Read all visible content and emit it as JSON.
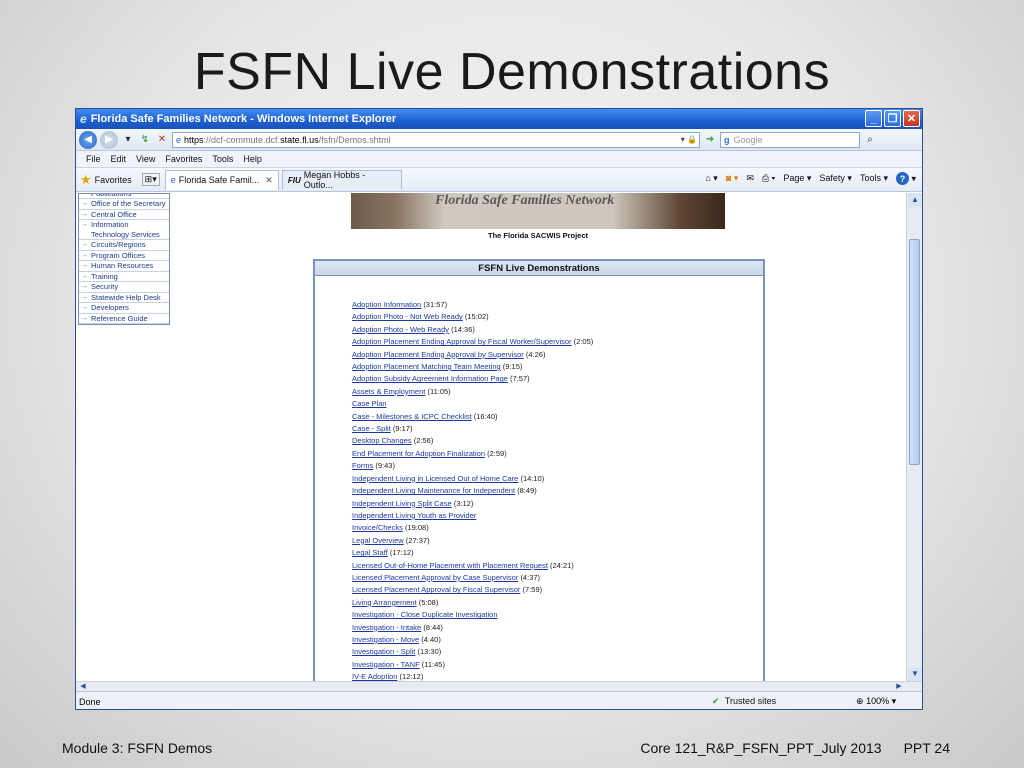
{
  "slide": {
    "title": "FSFN Live Demonstrations",
    "footer_left": "Module 3: FSFN Demos",
    "footer_center": "Core 121_R&P_FSFN_PPT_July 2013",
    "footer_right": "PPT 24"
  },
  "browser": {
    "title": "Florida Safe Families Network - Windows Internet Explorer",
    "url_scheme": "https",
    "url_prefix": "://dcf-commute.dcf.",
    "url_host": "state.fl.us",
    "url_path": "/fsfn/Demos.shtml",
    "search_placeholder": "Google",
    "menu": [
      "File",
      "Edit",
      "View",
      "Favorites",
      "Tools",
      "Help"
    ],
    "favorites_label": "Favorites",
    "tabs": [
      {
        "label": "Florida Safe Famil...",
        "active": true
      },
      {
        "label": "Megan Hobbs - Outlo...",
        "active": false
      }
    ],
    "commands": [
      "Page ▾",
      "Safety ▾",
      "Tools ▾"
    ],
    "status_text": "Done",
    "zone_text": "Trusted sites",
    "zoom_text": "100%"
  },
  "sidebar": {
    "items": [
      "Publications",
      "Office of the Secretary",
      "Central Office",
      "Information Technology Services",
      "Circuits/Regions",
      "Program Offices",
      "Human Resources",
      "Training",
      "Security",
      "Statewide Help Desk",
      "Developers",
      "Reference Guide"
    ]
  },
  "banner": {
    "text": "Florida Safe Families Network",
    "caption": "The Florida SACWIS Project"
  },
  "demos": {
    "header": "FSFN Live Demonstrations",
    "items": [
      {
        "title": "Adoption Information",
        "duration": "(31:57)"
      },
      {
        "title": "Adoption Photo - Not Web Ready",
        "duration": "(15:02)"
      },
      {
        "title": "Adoption Photo - Web Ready",
        "duration": "(14:36)"
      },
      {
        "title": "Adoption Placement Ending Approval by Fiscal Worker/Supervisor",
        "duration": "(2:05)"
      },
      {
        "title": "Adoption Placement Ending Approval by Supervisor",
        "duration": "(4:26)"
      },
      {
        "title": "Adoption Placement Matching Team Meeting",
        "duration": "(9:15)"
      },
      {
        "title": "Adoption Subsidy Agreement Information Page",
        "duration": "(7:57)"
      },
      {
        "title": "Assets & Employment",
        "duration": "(11:05)"
      },
      {
        "title": "Case Plan",
        "duration": ""
      },
      {
        "title": "Case - Milestones & ICPC Checklist",
        "duration": "(16:40)"
      },
      {
        "title": "Case - Split",
        "duration": "(9:17)"
      },
      {
        "title": "Desktop Changes",
        "duration": "(2:56)"
      },
      {
        "title": "End Placement for Adoption Finalization",
        "duration": "(2:59)"
      },
      {
        "title": "Forms",
        "duration": "(9:43)"
      },
      {
        "title": "Independent Living in Licensed Out of Home Care",
        "duration": "(14:10)"
      },
      {
        "title": "Independent Living Maintenance for Independent",
        "duration": "(8:49)"
      },
      {
        "title": "Independent Living Split Case",
        "duration": "(3:12)"
      },
      {
        "title": "Independent Living Youth as Provider",
        "duration": ""
      },
      {
        "title": "Invoice/Checks",
        "duration": "(19:08)"
      },
      {
        "title": "Legal Overview",
        "duration": "(27:37)"
      },
      {
        "title": "Legal Staff",
        "duration": "(17:12)"
      },
      {
        "title": "Licensed Out-of-Home Placement with Placement Request",
        "duration": "(24:21)"
      },
      {
        "title": "Licensed Placement Approval by Case Supervisor",
        "duration": "(4:37)"
      },
      {
        "title": "Licensed Placement Approval by Fiscal Supervisor",
        "duration": "(7:59)"
      },
      {
        "title": "Living Arrangement",
        "duration": "(5:08)"
      },
      {
        "title": "Investigation - Close Duplicate Investigation",
        "duration": ""
      },
      {
        "title": "Investigation - Intake",
        "duration": "(8:44)"
      },
      {
        "title": "Investigation - Move",
        "duration": "(4:40)"
      },
      {
        "title": "Investigation - Split",
        "duration": "(13:30)"
      },
      {
        "title": "Investigation - TANF",
        "duration": "(11:45)"
      },
      {
        "title": "IV-E Adoption",
        "duration": "(12:12)"
      }
    ]
  }
}
